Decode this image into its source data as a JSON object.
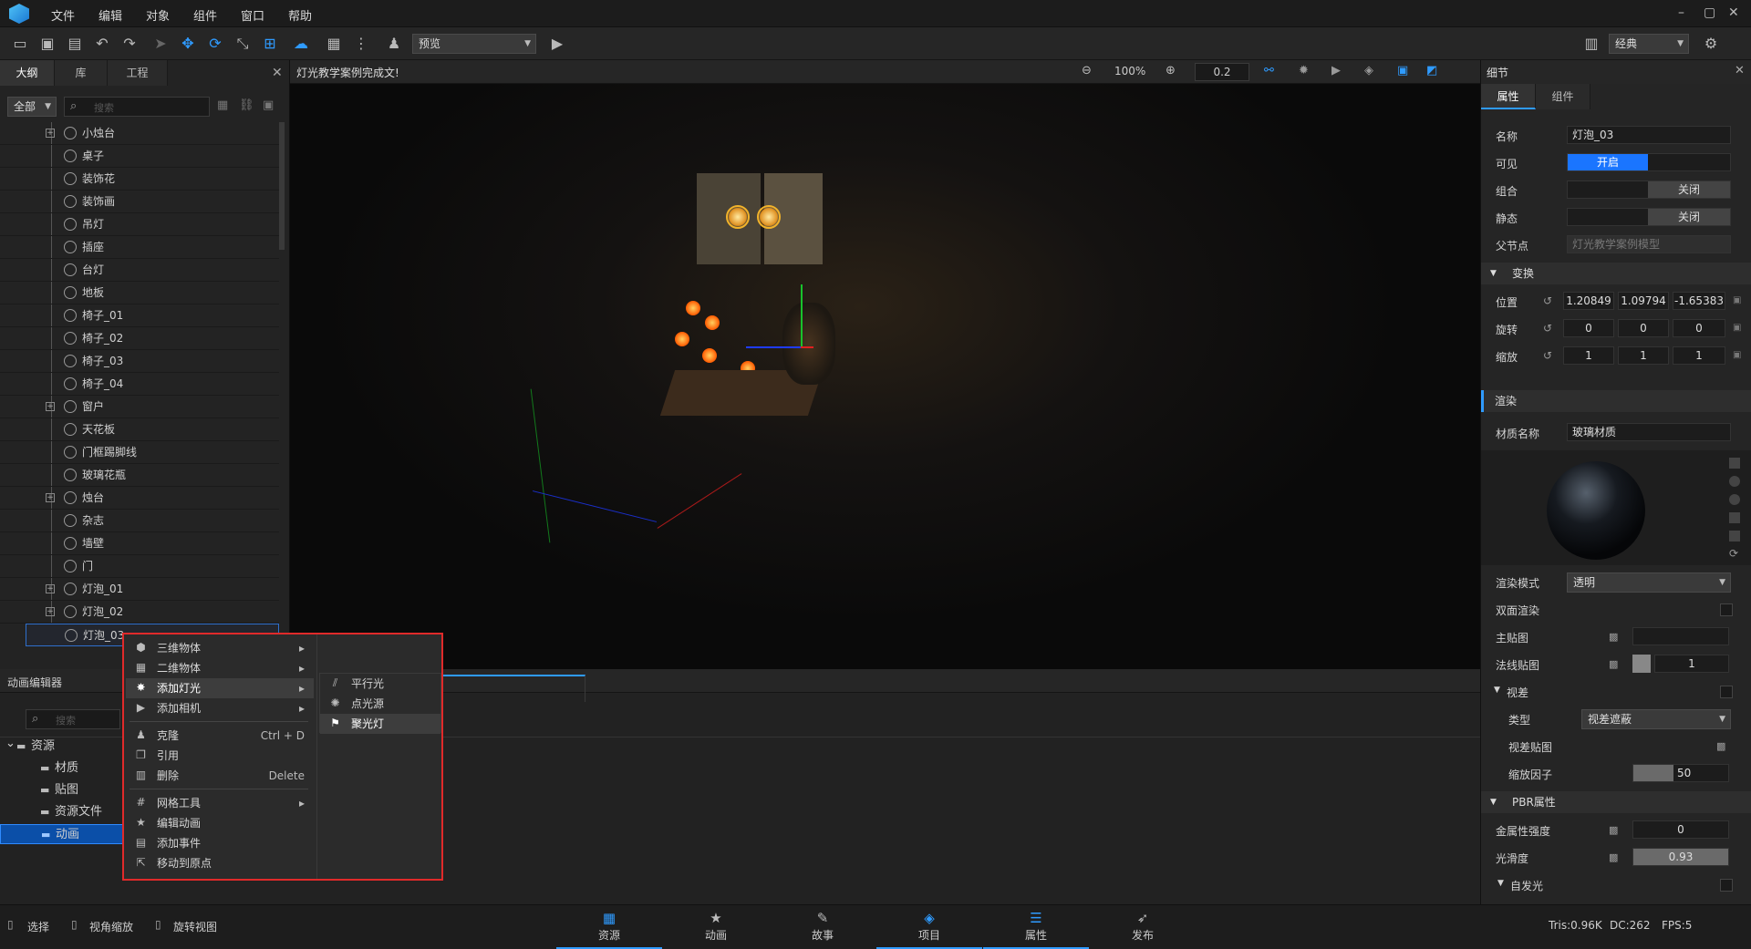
{
  "menubar": {
    "items": [
      "文件",
      "编辑",
      "对象",
      "组件",
      "窗口",
      "帮助"
    ],
    "window_controls": [
      "–",
      "▢",
      "✕"
    ]
  },
  "toolbar": {
    "mode_select": "预览",
    "layout_select": "经典"
  },
  "outline": {
    "tabs": [
      "大纲",
      "库",
      "工程"
    ],
    "filter": "全部",
    "search_placeholder": "搜索",
    "items": [
      {
        "label": "小烛台",
        "expandable": true
      },
      {
        "label": "桌子"
      },
      {
        "label": "装饰花"
      },
      {
        "label": "装饰画"
      },
      {
        "label": "吊灯"
      },
      {
        "label": "插座"
      },
      {
        "label": "台灯"
      },
      {
        "label": "地板"
      },
      {
        "label": "椅子_01"
      },
      {
        "label": "椅子_02"
      },
      {
        "label": "椅子_03"
      },
      {
        "label": "椅子_04"
      },
      {
        "label": "窗户",
        "expandable": true
      },
      {
        "label": "天花板"
      },
      {
        "label": "门框踢脚线"
      },
      {
        "label": "玻璃花瓶"
      },
      {
        "label": "烛台",
        "expandable": true
      },
      {
        "label": "杂志"
      },
      {
        "label": "墙壁"
      },
      {
        "label": "门"
      },
      {
        "label": "灯泡_01",
        "expandable": true
      },
      {
        "label": "灯泡_02",
        "expandable": true
      },
      {
        "label": "灯泡_03",
        "selected": true
      }
    ]
  },
  "viewport": {
    "title": "灯光教学案例完成文!",
    "zoom": "100%",
    "step": "0.2"
  },
  "details": {
    "title": "细节",
    "tabs": [
      "属性",
      "组件"
    ],
    "name_label": "名称",
    "name_value": "灯泡_03",
    "visible_label": "可见",
    "visible_value": "开启",
    "group_label": "组合",
    "group_value": "关闭",
    "static_label": "静态",
    "static_value": "关闭",
    "parent_label": "父节点",
    "parent_value": "灯光教学案例模型",
    "transform_title": "变换",
    "position_label": "位置",
    "position": [
      "1.20849",
      "1.09794",
      "-1.65383"
    ],
    "rotation_label": "旋转",
    "rotation": [
      "0",
      "0",
      "0"
    ],
    "scale_label": "缩放",
    "scale": [
      "1",
      "1",
      "1"
    ],
    "render_title": "渲染",
    "material_label": "材质名称",
    "material_value": "玻璃材质",
    "render_mode_label": "渲染模式",
    "render_mode_value": "透明",
    "double_side_label": "双面渲染",
    "main_map_label": "主贴图",
    "normal_map_label": "法线贴图",
    "normal_map_value": "1",
    "parallax_label": "视差",
    "type_label": "类型",
    "type_value": "视差遮蔽",
    "parallax_map_label": "视差贴图",
    "scale_factor_label": "缩放因子",
    "scale_factor_value": "50",
    "pbr_title": "PBR属性",
    "metal_label": "金属性强度",
    "metal_value": "0",
    "smooth_label": "光滑度",
    "smooth_value": "0.93",
    "emission_label": "自发光"
  },
  "anim": {
    "title": "动画编辑器",
    "search_placeholder": "搜索",
    "tree": [
      {
        "label": "资源",
        "level": 0
      },
      {
        "label": "材质",
        "level": 1
      },
      {
        "label": "贴图",
        "level": 1
      },
      {
        "label": "资源文件",
        "level": 1
      },
      {
        "label": "动画",
        "level": 1,
        "selected": true
      }
    ]
  },
  "context_menu": {
    "items": [
      {
        "label": "三维物体",
        "submenu": true,
        "icon": "cube-icon"
      },
      {
        "label": "二维物体",
        "submenu": true,
        "icon": "grid-icon"
      },
      {
        "label": "添加灯光",
        "submenu": true,
        "icon": "sun-icon",
        "highlight": true
      },
      {
        "label": "添加相机",
        "submenu": true,
        "icon": "camera-icon"
      },
      {
        "label": "克隆",
        "shortcut": "Ctrl + D",
        "icon": "person-icon"
      },
      {
        "label": "引用",
        "icon": "copy-icon"
      },
      {
        "label": "删除",
        "shortcut": "Delete",
        "icon": "trash-icon"
      },
      {
        "label": "网格工具",
        "submenu": true,
        "icon": "mesh-icon"
      },
      {
        "label": "编辑动画",
        "icon": "star-icon"
      },
      {
        "label": "添加事件",
        "icon": "event-icon"
      },
      {
        "label": "移动到原点",
        "icon": "origin-icon"
      }
    ],
    "submenu": [
      {
        "label": "平行光"
      },
      {
        "label": "点光源"
      },
      {
        "label": "聚光灯",
        "highlight": true
      }
    ]
  },
  "statusbar": {
    "select": "选择",
    "view_zoom": "视角缩放",
    "rotate_view": "旋转视图",
    "tabs": [
      "资源",
      "动画",
      "故事",
      "项目",
      "属性",
      "发布"
    ],
    "tris": "Tris:0.96K",
    "dc": "DC:262",
    "fps": "FPS:5"
  }
}
